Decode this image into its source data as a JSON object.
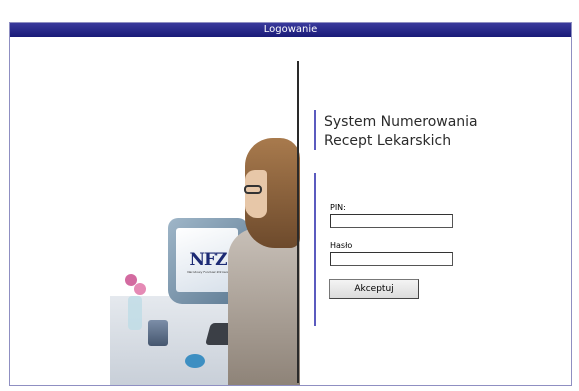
{
  "header": {
    "title": "Logowanie"
  },
  "app": {
    "title_line1": "System Numerowania",
    "title_line2": "Recept Lekarskich"
  },
  "photo": {
    "logo_text": "NFZ",
    "logo_subtext": "Narodowy Fundusz Zdrowia"
  },
  "form": {
    "pin_label": "PIN:",
    "pin_value": "",
    "password_label": "Hasło",
    "password_value": "",
    "submit_label": "Akceptuj"
  },
  "colors": {
    "titlebar": "#1f1f80",
    "accent": "#5b5bbf"
  }
}
